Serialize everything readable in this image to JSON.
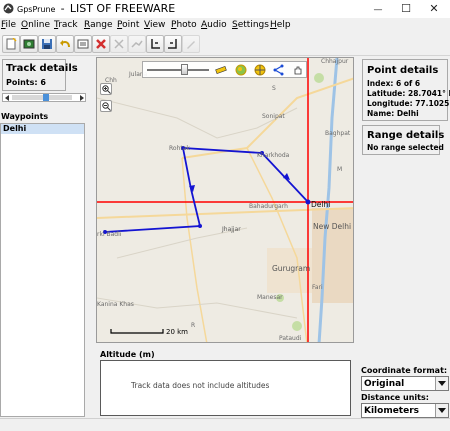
{
  "window": {
    "app_name": "GpsPrune",
    "separator": "-",
    "title": "LIST OF FREEWARE",
    "minimize": "—",
    "maximize": "☐",
    "close": "✕"
  },
  "menu": [
    "File",
    "Online",
    "Track",
    "Range",
    "Point",
    "View",
    "Photo",
    "Audio",
    "Settings",
    "Help"
  ],
  "toolbar_icons": [
    "new-file-icon",
    "open-photo-icon",
    "save-icon",
    "undo-icon",
    "edit-icon",
    "delete-icon",
    "cut-icon",
    "delete-range-icon",
    "start-range-icon",
    "end-range-icon",
    "pencil-icon"
  ],
  "track_details": {
    "title": "Track details",
    "points_label": "Points:",
    "points_value": "6"
  },
  "waypoints": {
    "title": "Waypoints",
    "items": [
      "Delhi"
    ]
  },
  "map": {
    "labels": {
      "chhajpur": "Chhajpur",
      "julana": "Julana",
      "kharkhoda": "Kharkhoda",
      "sonipat": "Sonipat",
      "rohtak": "Rohtak",
      "baghpat": "Baghpat",
      "bahadurgarh": "Bahadurgarh",
      "delhi": "Delhi",
      "new_delhi": "New Delhi",
      "jhajjar": "Jhajjar",
      "badli": "rki Badli",
      "gurugram": "Gurugram",
      "fari": "Fari",
      "manesar": "Manesar",
      "kanina_khas": "Kanina Khas",
      "pataudi": "Pataudi",
      "scale": "20 km",
      "chh": "Chh",
      "r_label": "R",
      "s_label": "S",
      "m_label": "M"
    },
    "route_color": "#1414d2",
    "crosshair_color": "#ff0000"
  },
  "altitude": {
    "title": "Altitude (m)",
    "message": "Track data does not include altitudes"
  },
  "point_details": {
    "title": "Point details",
    "index": "Index: 6 of 6",
    "latitude": "Latitude: 28.7041° N",
    "longitude": "Longitude: 77.1025...",
    "name": "Name: Delhi"
  },
  "range_details": {
    "title": "Range details",
    "status": "No range selected"
  },
  "coordinate_format": {
    "label": "Coordinate format:",
    "value": "Original"
  },
  "distance_units": {
    "label": "Distance units:",
    "value": "Kilometers"
  }
}
